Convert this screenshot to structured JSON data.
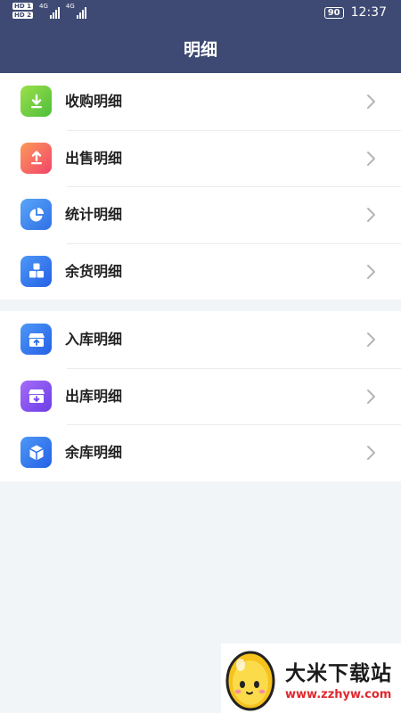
{
  "status_bar": {
    "hd1": "HD 1",
    "hd2": "HD 2",
    "net1": "4G",
    "net2": "4G",
    "battery": "90",
    "time": "12:37"
  },
  "header": {
    "title": "明细"
  },
  "group1": [
    {
      "label": "收购明细",
      "icon": "download-icon",
      "color": "#5cc43c"
    },
    {
      "label": "出售明细",
      "icon": "upload-icon",
      "color": "#f4566a"
    },
    {
      "label": "统计明细",
      "icon": "pie-chart-icon",
      "color": "#3b7ff0"
    },
    {
      "label": "余货明细",
      "icon": "boxes-icon",
      "color": "#2f6fe6"
    }
  ],
  "group2": [
    {
      "label": "入库明细",
      "icon": "inbox-in-icon",
      "color": "#2f6fe6"
    },
    {
      "label": "出库明细",
      "icon": "inbox-out-icon",
      "color": "#7b45ee"
    },
    {
      "label": "余库明细",
      "icon": "cube-icon",
      "color": "#2f6fe6"
    }
  ],
  "watermark": {
    "title": "大米下载站",
    "url": "www.zzhyw.com"
  }
}
